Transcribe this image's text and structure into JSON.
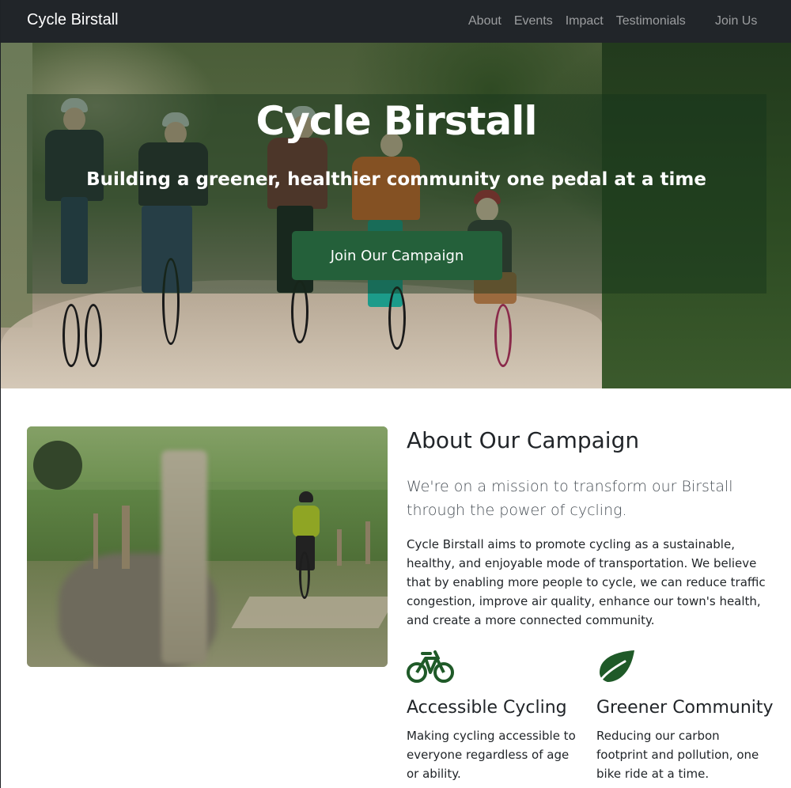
{
  "nav": {
    "brand": "Cycle Birstall",
    "links": [
      "About",
      "Events",
      "Impact",
      "Testimonials"
    ],
    "join": "Join Us"
  },
  "hero": {
    "title": "Cycle Birstall",
    "subtitle": "Building a greener, healthier community one pedal at a time",
    "cta": "Join Our Campaign"
  },
  "about": {
    "heading": "About Our Campaign",
    "lead": "We're on a mission to transform our Birstall through the power of cycling.",
    "body": "Cycle Birstall aims to promote cycling as a sustainable, healthy, and enjoyable mode of transportation. We believe that by enabling more people to cycle, we can reduce traffic congestion, improve air quality, enhance our town's health, and create a more connected community.",
    "features": [
      {
        "icon": "bicycle-icon",
        "title": "Accessible Cycling",
        "text": "Making cycling accessible to everyone regardless of age or ability."
      },
      {
        "icon": "leaf-icon",
        "title": "Greener Community",
        "text": "Reducing our carbon footprint and pollution, one bike ride at a time."
      }
    ]
  },
  "colors": {
    "accent": "#1f5a28",
    "navbar": "#212529",
    "button": "#24603a"
  }
}
